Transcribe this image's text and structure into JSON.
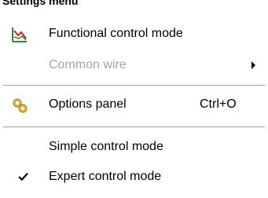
{
  "header": {
    "title": "Settings menu"
  },
  "menu": {
    "items": [
      {
        "label": "Functional control mode",
        "icon": "chart-icon",
        "enabled": true
      },
      {
        "label": "Common wire",
        "enabled": false,
        "has_submenu": true
      },
      {
        "label": "Options panel",
        "icon": "gears-icon",
        "shortcut": "Ctrl+O",
        "enabled": true
      },
      {
        "label": "Simple control mode",
        "enabled": true
      },
      {
        "label": "Expert control mode",
        "enabled": true,
        "checked": true
      }
    ]
  },
  "colors": {
    "disabled_text": "#a3a3a3",
    "chart_red": "#d81e1e",
    "chart_green": "#2e8b2e",
    "gear_gold": "#c89a1c"
  }
}
